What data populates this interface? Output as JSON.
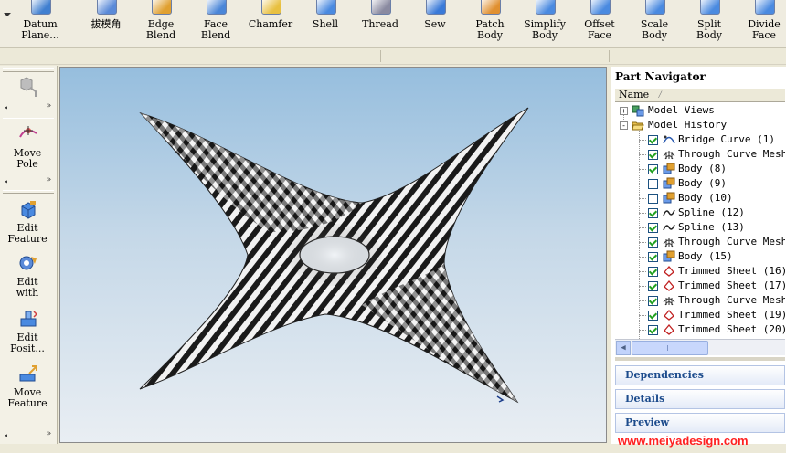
{
  "toolbar": {
    "buttons": [
      {
        "label": "Datum\nPlane...",
        "icon": "datum-plane-icon",
        "color": "#3f7fd0"
      },
      {
        "label": "拔模角",
        "icon": "draft-icon",
        "color": "#5a8ad8"
      },
      {
        "label": "Edge\nBlend",
        "icon": "edge-blend-icon",
        "color": "#e0a030"
      },
      {
        "label": "Face\nBlend",
        "icon": "face-blend-icon",
        "color": "#4a86d8"
      },
      {
        "label": "Chamfer",
        "icon": "chamfer-icon",
        "color": "#e8c040"
      },
      {
        "label": "Shell",
        "icon": "shell-icon",
        "color": "#4a8ae0"
      },
      {
        "label": "Thread",
        "icon": "thread-icon",
        "color": "#8a8aa0"
      },
      {
        "label": "Sew",
        "icon": "sew-icon",
        "color": "#3a7ad8"
      },
      {
        "label": "Patch\nBody",
        "icon": "patch-body-icon",
        "color": "#e09030"
      },
      {
        "label": "Simplify\nBody",
        "icon": "simplify-body-icon",
        "color": "#4a8ae0"
      },
      {
        "label": "Offset\nFace",
        "icon": "offset-face-icon",
        "color": "#4a8ae0"
      },
      {
        "label": "Scale\nBody",
        "icon": "scale-body-icon",
        "color": "#4a8ae0"
      },
      {
        "label": "Split\nBody",
        "icon": "split-body-icon",
        "color": "#4a8ae0"
      },
      {
        "label": "Divide\nFace",
        "icon": "divide-face-icon",
        "color": "#4a8ae0"
      }
    ]
  },
  "palette": {
    "buttons": [
      {
        "label": "Move\nPole",
        "icon": "move-pole-icon"
      },
      {
        "label": "Edit\nFeature",
        "icon": "edit-feature-icon"
      },
      {
        "label": "Edit\nwith",
        "icon": "edit-with-icon"
      },
      {
        "label": "Edit\nPosit...",
        "icon": "edit-position-icon"
      },
      {
        "label": "Move\nFeature",
        "icon": "move-feature-icon"
      }
    ]
  },
  "navigator": {
    "title": "Part Navigator",
    "column_name": "Name",
    "groups": [
      {
        "label": "Model Views",
        "expander": "+",
        "icon": "model-views-icon"
      },
      {
        "label": "Model History",
        "expander": "-",
        "icon": "folder-open-icon"
      }
    ],
    "items": [
      {
        "label": "Bridge Curve (1)",
        "checked": true,
        "icon": "bridge-curve-icon"
      },
      {
        "label": "Through Curve Mesh",
        "checked": true,
        "icon": "through-curve-mesh-icon"
      },
      {
        "label": "Body (8)",
        "checked": true,
        "icon": "body-icon"
      },
      {
        "label": "Body (9)",
        "checked": false,
        "icon": "body-icon"
      },
      {
        "label": "Body (10)",
        "checked": false,
        "icon": "body-icon"
      },
      {
        "label": "Spline (12)",
        "checked": true,
        "icon": "spline-icon"
      },
      {
        "label": "Spline (13)",
        "checked": true,
        "icon": "spline-icon"
      },
      {
        "label": "Through Curve Mesh",
        "checked": true,
        "icon": "through-curve-mesh-icon"
      },
      {
        "label": "Body (15)",
        "checked": true,
        "icon": "body-icon"
      },
      {
        "label": "Trimmed Sheet (16)",
        "checked": true,
        "icon": "trimmed-sheet-icon"
      },
      {
        "label": "Trimmed Sheet (17)",
        "checked": true,
        "icon": "trimmed-sheet-icon"
      },
      {
        "label": "Through Curve Mesh",
        "checked": true,
        "icon": "through-curve-mesh-icon"
      },
      {
        "label": "Trimmed Sheet (19)",
        "checked": true,
        "icon": "trimmed-sheet-icon"
      },
      {
        "label": "Trimmed Sheet (20)",
        "checked": true,
        "icon": "trimmed-sheet-icon"
      }
    ],
    "panels": [
      "Dependencies",
      "Details",
      "Preview"
    ]
  },
  "watermark": "www.meiyadesign.com"
}
